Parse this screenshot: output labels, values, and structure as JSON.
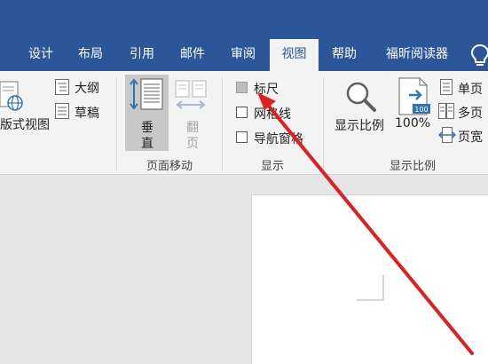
{
  "tabs": [
    {
      "label": "设计"
    },
    {
      "label": "布局"
    },
    {
      "label": "引用"
    },
    {
      "label": "邮件"
    },
    {
      "label": "审阅"
    },
    {
      "label": "视图"
    },
    {
      "label": "帮助"
    },
    {
      "label": "福昕阅读器"
    }
  ],
  "active_tab": "视图",
  "ribbon": {
    "views": {
      "web_layout_label": "版式视图",
      "outline_label": "大纲",
      "draft_label": "草稿"
    },
    "page_movement": {
      "vertical_label_1": "垂",
      "vertical_label_2": "直",
      "side_by_side_label_1": "翻",
      "side_by_side_label_2": "页",
      "group_label": "页面移动"
    },
    "show": {
      "ruler_label": "标尺",
      "ruler_checked": true,
      "gridlines_label": "网格线",
      "gridlines_checked": false,
      "nav_pane_label": "导航窗格",
      "nav_pane_checked": false,
      "group_label": "显示"
    },
    "zoom": {
      "zoom_label": "显示比例",
      "percent_value": "100",
      "percent_label": "100%",
      "one_page_label": "单页",
      "multi_page_label": "多页",
      "page_width_label": "页宽",
      "group_label": "显示比例"
    }
  },
  "colors": {
    "titlebar": "#2b579a",
    "ribbon_bg": "#f3f3f3",
    "annotation_arrow": "#e02020",
    "icon_blue": "#2e75b6"
  }
}
